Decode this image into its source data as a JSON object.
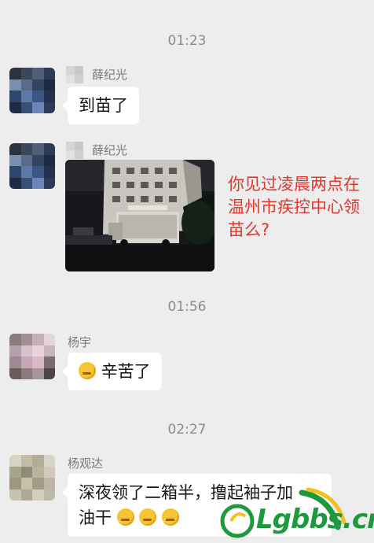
{
  "chat": {
    "timestamps": [
      "01:23",
      "01:56",
      "02:27"
    ],
    "messages": [
      {
        "sender": "薛纪光",
        "text": "到苗了"
      },
      {
        "sender": "薛纪光",
        "caption": "你见过凌晨两点在温州市疾控中心领苗么?"
      },
      {
        "sender": "杨宇",
        "text": "辛苦了"
      },
      {
        "sender": "杨观达",
        "text_line1": "深夜领了二箱半，撸起袖子加",
        "text_line2": "油干"
      }
    ]
  },
  "watermark": {
    "text": "Lgbbs.cn"
  },
  "colors": {
    "background": "#ededed",
    "caption_red": "#e5352d",
    "bubble": "#ffffff",
    "watermark_green": "#1d9a3d"
  },
  "icons": [
    "pixelated-avatar",
    "working-emoji",
    "thinking-emoji"
  ]
}
